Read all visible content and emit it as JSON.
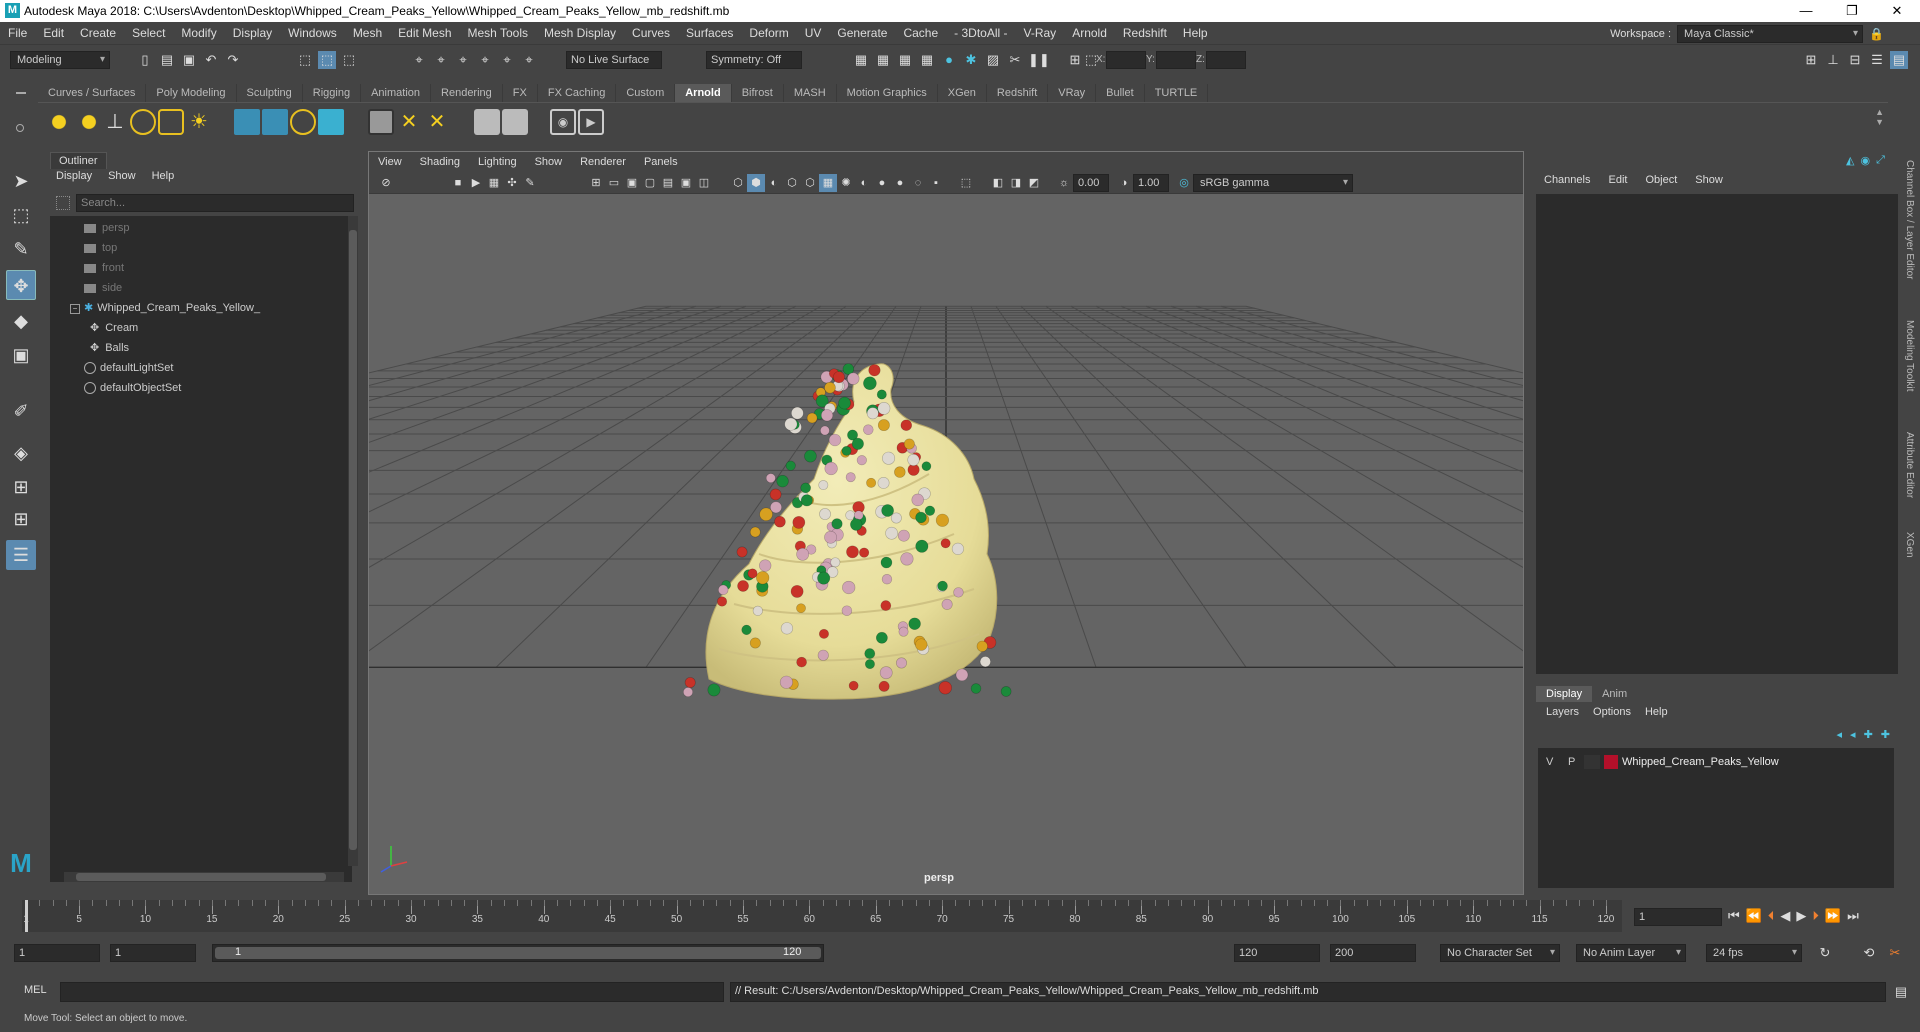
{
  "title_bar": {
    "title": "Autodesk Maya 2018: C:\\Users\\Avdenton\\Desktop\\Whipped_Cream_Peaks_Yellow\\Whipped_Cream_Peaks_Yellow_mb_redshift.mb",
    "logo": "M",
    "minimize": "—",
    "maximize": "❐",
    "close": "✕"
  },
  "menu_bar": {
    "items": [
      "File",
      "Edit",
      "Create",
      "Select",
      "Modify",
      "Display",
      "Windows",
      "Mesh",
      "Edit Mesh",
      "Mesh Tools",
      "Mesh Display",
      "Curves",
      "Surfaces",
      "Deform",
      "UV",
      "Generate",
      "Cache",
      "- 3DtoAll -",
      "V-Ray",
      "Arnold",
      "Redshift",
      "Help"
    ],
    "workspace_label": "Workspace :",
    "workspace_value": "Maya Classic*"
  },
  "status_line": {
    "mode": "Modeling",
    "live_surface": "No Live Surface",
    "symmetry": "Symmetry: Off",
    "x_label": "X:",
    "y_label": "Y:",
    "z_label": "Z:"
  },
  "shelf": {
    "tabs": [
      "Curves / Surfaces",
      "Poly Modeling",
      "Sculpting",
      "Rigging",
      "Animation",
      "Rendering",
      "FX",
      "FX Caching",
      "Custom",
      "Arnold",
      "Bifrost",
      "MASH",
      "Motion Graphics",
      "XGen",
      "Redshift",
      "VRay",
      "Bullet",
      "TURTLE"
    ],
    "active_tab": "Arnold"
  },
  "outliner": {
    "tab": "Outliner",
    "menu": [
      "Display",
      "Show",
      "Help"
    ],
    "search_placeholder": "Search...",
    "items": [
      {
        "label": "persp",
        "dim": true
      },
      {
        "label": "top",
        "dim": true
      },
      {
        "label": "front",
        "dim": true
      },
      {
        "label": "side",
        "dim": true
      },
      {
        "label": "Whipped_Cream_Peaks_Yellow_",
        "dim": false
      },
      {
        "label": "Cream",
        "dim": false
      },
      {
        "label": "Balls",
        "dim": false
      },
      {
        "label": "defaultLightSet",
        "dim": false
      },
      {
        "label": "defaultObjectSet",
        "dim": false
      }
    ]
  },
  "viewport": {
    "menu": [
      "View",
      "Shading",
      "Lighting",
      "Show",
      "Renderer",
      "Panels"
    ],
    "exposure": "0.00",
    "gamma": "1.00",
    "color_space": "sRGB gamma",
    "camera_label": "persp"
  },
  "channel_box": {
    "menu": [
      "Channels",
      "Edit",
      "Object",
      "Show"
    ],
    "layer_tabs": [
      "Display",
      "Anim"
    ],
    "layer_menu": [
      "Layers",
      "Options",
      "Help"
    ],
    "layer": {
      "v": "V",
      "p": "P",
      "name": "Whipped_Cream_Peaks_Yellow",
      "color": "#b3102a"
    }
  },
  "side_tabs": [
    "Channel Box / Layer Editor",
    "Modeling Toolkit",
    "Attribute Editor",
    "XGen"
  ],
  "time_slider": {
    "ticks": [
      "1",
      "5",
      "10",
      "15",
      "20",
      "25",
      "30",
      "35",
      "40",
      "45",
      "50",
      "55",
      "60",
      "65",
      "70",
      "75",
      "80",
      "85",
      "90",
      "95",
      "100",
      "105",
      "110",
      "115",
      "120"
    ],
    "current_frame": "1"
  },
  "range_slider": {
    "start": "1",
    "playback_start": "1",
    "range_start_label": "1",
    "range_end_label": "120",
    "playback_end": "120",
    "end": "200",
    "character_set": "No Character Set",
    "anim_layer": "No Anim Layer",
    "fps": "24 fps"
  },
  "command_line": {
    "lang": "MEL",
    "result": "// Result: C:/Users/Avdenton/Desktop/Whipped_Cream_Peaks_Yellow/Whipped_Cream_Peaks_Yellow_mb_redshift.mb"
  },
  "help_line": {
    "text": "Move Tool: Select an object to move."
  },
  "colors": {
    "cream": "#e8e0a0",
    "ball_green": "#1a8a3a",
    "ball_red": "#c83228",
    "ball_gold": "#d7a020",
    "ball_pink": "#cfa3b5",
    "ball_white": "#ddd8d0"
  }
}
